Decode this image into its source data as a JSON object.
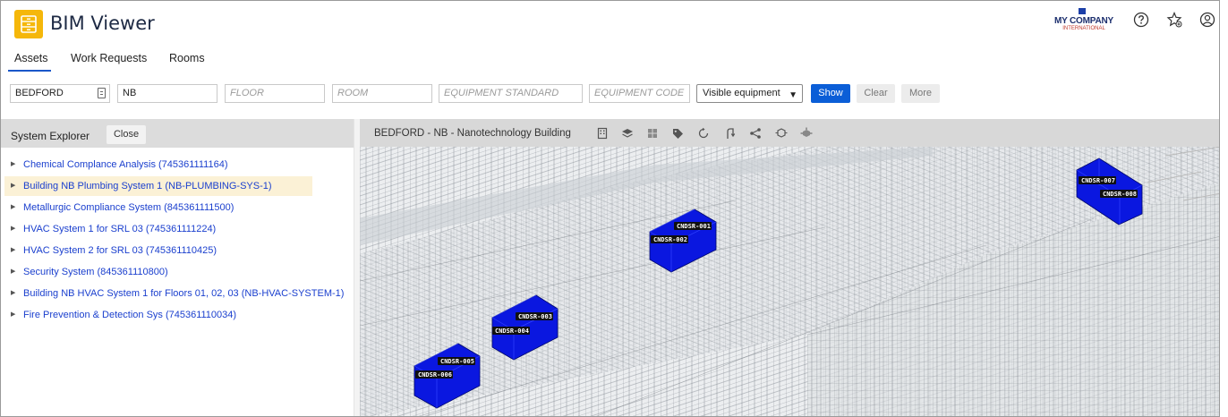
{
  "app": {
    "title": "BIM Viewer"
  },
  "company": {
    "name": "MY COMPANY",
    "sub": "INTERNATIONAL"
  },
  "tabs": [
    {
      "label": "Assets",
      "active": true
    },
    {
      "label": "Work Requests",
      "active": false
    },
    {
      "label": "Rooms",
      "active": false
    }
  ],
  "filters": {
    "site": {
      "value": "BEDFORD"
    },
    "building": {
      "value": "NB"
    },
    "floor": {
      "placeholder": "FLOOR"
    },
    "room": {
      "placeholder": "ROOM"
    },
    "equipment_standard": {
      "placeholder": "EQUIPMENT STANDARD"
    },
    "equipment_code": {
      "placeholder": "EQUIPMENT CODE"
    },
    "visibility": {
      "selected": "Visible equipment"
    },
    "show_label": "Show",
    "clear_label": "Clear",
    "more_label": "More"
  },
  "explorer": {
    "title": "System Explorer",
    "close_label": "Close",
    "items": [
      {
        "label": "Chemical Complance Analysis (745361111164)"
      },
      {
        "label": "Building NB Plumbing System 1 (NB-PLUMBING-SYS-1)",
        "selected": true
      },
      {
        "label": "Metallurgic Compliance System (845361111500)"
      },
      {
        "label": "HVAC System 1 for SRL 03 (745361111224)"
      },
      {
        "label": "HVAC System 2 for SRL 03 (745361110425)"
      },
      {
        "label": "Security System (845361110800)"
      },
      {
        "label": "Building NB HVAC System 1 for Floors 01, 02, 03 (NB-HVAC-SYSTEM-1)"
      },
      {
        "label": "Fire Prevention & Detection Sys (745361110034)"
      }
    ]
  },
  "viewer": {
    "title": "BEDFORD - NB - Nanotechnology Building",
    "toolbar": [
      "building-icon",
      "layers-icon",
      "grid-icon",
      "tag-icon",
      "rotate-icon",
      "route-icon",
      "share-icon",
      "explode-icon",
      "cube-move-icon"
    ],
    "equipment": [
      "CNDSR-001",
      "CNDSR-002",
      "CNDSR-003",
      "CNDSR-004",
      "CNDSR-005",
      "CNDSR-006",
      "CNDSR-007",
      "CNDSR-008"
    ]
  },
  "colors": {
    "accent": "#0b5ed7",
    "link": "#1a3fce",
    "equipment": "#0a17e0",
    "selected_row": "#fbf1d6",
    "app_icon": "#f5b70a"
  }
}
